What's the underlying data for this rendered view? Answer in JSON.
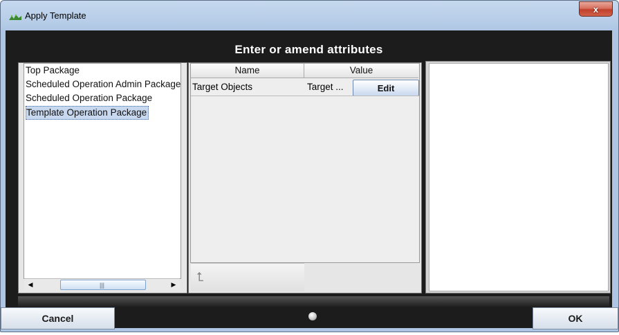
{
  "window": {
    "title": "Apply Template",
    "close_symbol": "x"
  },
  "header": {
    "title": "Enter or amend attributes"
  },
  "packages": [
    {
      "label": "Top Package",
      "selected": false
    },
    {
      "label": "Scheduled Operation Admin Package",
      "selected": false
    },
    {
      "label": "Scheduled Operation Package",
      "selected": false
    },
    {
      "label": "Template Operation Package",
      "selected": true
    }
  ],
  "scrollbar": {
    "left_arrow": "◀",
    "right_arrow": "▶",
    "grip": "|||"
  },
  "attributes_table": {
    "columns": [
      "Name",
      "Value"
    ],
    "rows": [
      {
        "name": "Target Objects",
        "value": "Target ...",
        "action": "Edit"
      }
    ]
  },
  "up_button": {
    "icon": "up-arrow-icon",
    "symbol": "⮤"
  },
  "footer": {
    "cancel_label": "Cancel",
    "ok_label": "OK"
  }
}
